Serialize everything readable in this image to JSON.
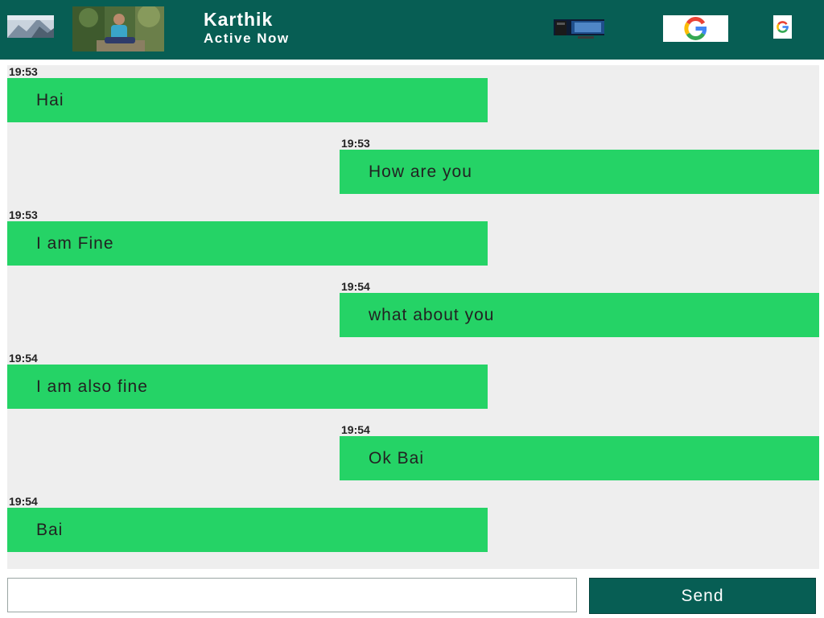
{
  "header": {
    "contact_name": "Karthik",
    "contact_status": "Active Now",
    "background_color": "#075e54",
    "icons": {
      "back": "back-photo-icon",
      "avatar": "profile-photo-avatar",
      "video": "monitor-icon",
      "google": "google-logo-icon",
      "google_small": "google-g-icon"
    }
  },
  "messages": [
    {
      "side": "left",
      "time": "19:53",
      "text": "Hai"
    },
    {
      "side": "right",
      "time": "19:53",
      "text": "How are you"
    },
    {
      "side": "left",
      "time": "19:53",
      "text": "I am Fine"
    },
    {
      "side": "right",
      "time": "19:54",
      "text": "what about you"
    },
    {
      "side": "left",
      "time": "19:54",
      "text": "I am also fine"
    },
    {
      "side": "right",
      "time": "19:54",
      "text": "Ok Bai"
    },
    {
      "side": "left",
      "time": "19:54",
      "text": "Bai"
    }
  ],
  "composer": {
    "input_value": "",
    "placeholder": "",
    "send_label": "Send"
  },
  "colors": {
    "bubble": "#25d366",
    "chat_background": "#eeeeee",
    "accent": "#075e54"
  }
}
